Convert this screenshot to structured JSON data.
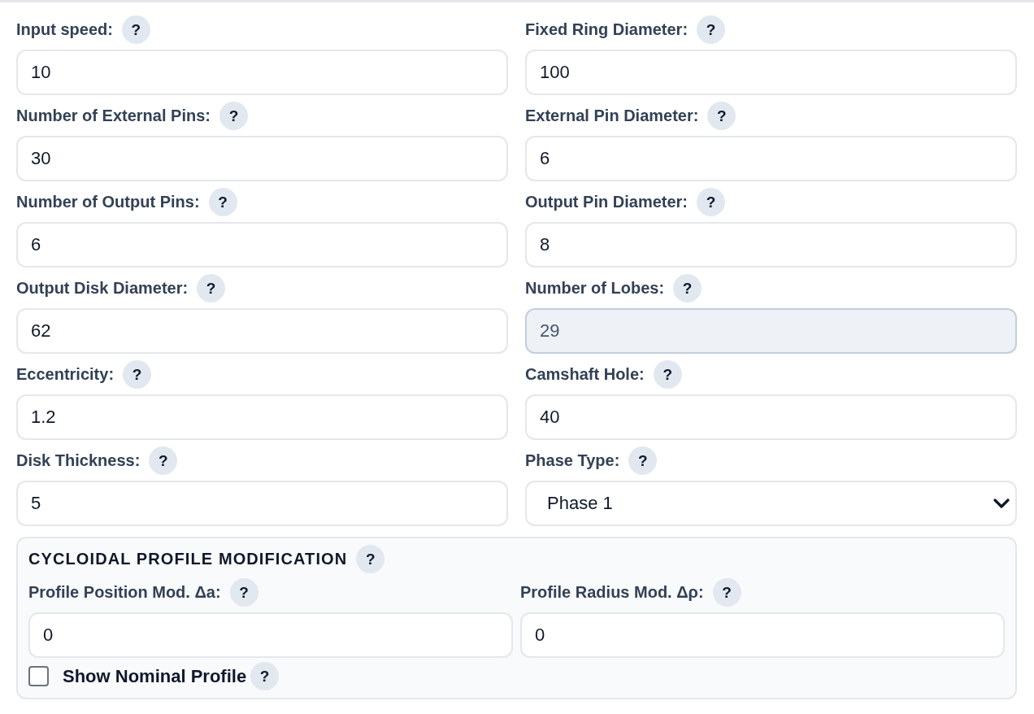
{
  "fields": [
    {
      "label": "Input speed:",
      "help": "?",
      "kind": "input",
      "value": "10",
      "disabled": false
    },
    {
      "label": "Fixed Ring Diameter:",
      "help": "?",
      "kind": "input",
      "value": "100",
      "disabled": false
    },
    {
      "label": "Number of External Pins:",
      "help": "?",
      "kind": "input",
      "value": "30",
      "disabled": false
    },
    {
      "label": "External Pin Diameter:",
      "help": "?",
      "kind": "input",
      "value": "6",
      "disabled": false
    },
    {
      "label": "Number of Output Pins:",
      "help": "?",
      "kind": "input",
      "value": "6",
      "disabled": false
    },
    {
      "label": "Output Pin Diameter:",
      "help": "?",
      "kind": "input",
      "value": "8",
      "disabled": false
    },
    {
      "label": "Output Disk Diameter:",
      "help": "?",
      "kind": "input",
      "value": "62",
      "disabled": false
    },
    {
      "label": "Number of Lobes:",
      "help": "?",
      "kind": "input",
      "value": "29",
      "disabled": true
    },
    {
      "label": "Eccentricity:",
      "help": "?",
      "kind": "input",
      "value": "1.2",
      "disabled": false
    },
    {
      "label": "Camshaft Hole:",
      "help": "?",
      "kind": "input",
      "value": "40",
      "disabled": false
    },
    {
      "label": "Disk Thickness:",
      "help": "?",
      "kind": "input",
      "value": "5",
      "disabled": false
    },
    {
      "label": "Phase Type:",
      "help": "?",
      "kind": "select",
      "value": "Phase 1",
      "disabled": false
    }
  ],
  "profile_modification": {
    "title": "CYCLOIDAL PROFILE MODIFICATION",
    "help": "?",
    "fields": [
      {
        "label": "Profile Position Mod. Δa:",
        "help": "?",
        "kind": "input",
        "value": "0",
        "disabled": false
      },
      {
        "label": "Profile Radius Mod. Δρ:",
        "help": "?",
        "kind": "input",
        "value": "0",
        "disabled": false
      }
    ],
    "checkbox": {
      "label": "Show Nominal Profile",
      "help": "?",
      "checked": false
    }
  }
}
